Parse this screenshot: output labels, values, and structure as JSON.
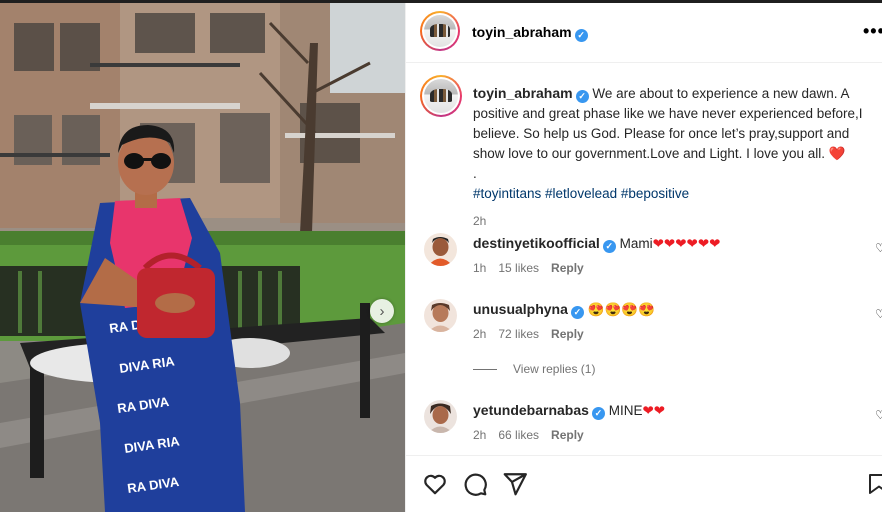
{
  "post": {
    "author": "toyin_abraham",
    "verified": true,
    "caption_username": "toyin_abraham",
    "caption_text": "We are about to experience a new dawn. A positive and great phase like we have never experienced before,I believe. So help us God. Please for once let’s pray,support and show love to our government.Love and Light. I love you all.",
    "caption_emoji": "❤️",
    "caption_dot": ".",
    "hashtags": "#toyintitans #letlovelead #bepositive",
    "caption_time": "2h"
  },
  "comments": [
    {
      "username": "destinyetikoofficial",
      "verified": true,
      "text": "Mami",
      "emoji": "❤❤❤❤❤❤",
      "time": "1h",
      "likes": "15 likes",
      "reply": "Reply"
    },
    {
      "username": "unusualphyna",
      "verified": true,
      "text": "",
      "emoji": "😍😍😍😍",
      "time": "2h",
      "likes": "72 likes",
      "reply": "Reply"
    },
    {
      "username": "yetundebarnabas",
      "verified": true,
      "text": "MINE",
      "emoji": "❤❤",
      "time": "2h",
      "likes": "66 likes",
      "reply": "Reply"
    }
  ],
  "view_replies": "View replies (1)",
  "icons": {
    "verified": "verified-badge-icon",
    "more": "more-options-icon",
    "like": "heart-outline-icon",
    "comment": "comment-bubble-icon",
    "share": "paper-plane-icon",
    "save": "bookmark-icon",
    "next": "chevron-right-icon"
  },
  "colors": {
    "verified": "#3897f0",
    "hashtag": "#00376b",
    "heart": "#ed1c24",
    "muted": "#737373"
  },
  "glyphs": {
    "verified_check": "✓",
    "more": "•••",
    "next": "›"
  }
}
